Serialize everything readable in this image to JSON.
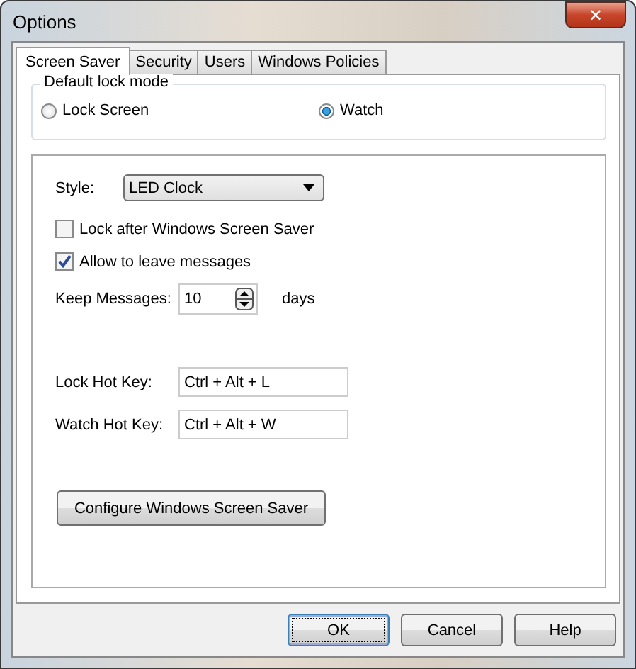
{
  "window": {
    "title": "Options",
    "close": "✕"
  },
  "tabs": [
    {
      "label": "Screen Saver",
      "selected": true
    },
    {
      "label": "Security",
      "selected": false
    },
    {
      "label": "Users",
      "selected": false
    },
    {
      "label": "Windows Policies",
      "selected": false
    }
  ],
  "lock_mode": {
    "legend": "Default lock mode",
    "options": [
      {
        "label": "Lock Screen",
        "selected": false
      },
      {
        "label": "Watch",
        "selected": true
      }
    ]
  },
  "style": {
    "label": "Style:",
    "value": "LED Clock"
  },
  "checkboxes": [
    {
      "label": "Lock after Windows Screen Saver",
      "checked": false
    },
    {
      "label": "Allow to leave messages",
      "checked": true
    }
  ],
  "keep_messages": {
    "label": "Keep Messages:",
    "value": "10",
    "unit": "days"
  },
  "hot_keys": [
    {
      "label": "Lock Hot Key:",
      "value": "Ctrl + Alt + L"
    },
    {
      "label": "Watch Hot Key:",
      "value": "Ctrl + Alt + W"
    }
  ],
  "configure_button": "Configure Windows Screen Saver",
  "buttons": [
    {
      "label": "OK",
      "default": true
    },
    {
      "label": "Cancel",
      "default": false
    },
    {
      "label": "Help",
      "default": false
    }
  ]
}
